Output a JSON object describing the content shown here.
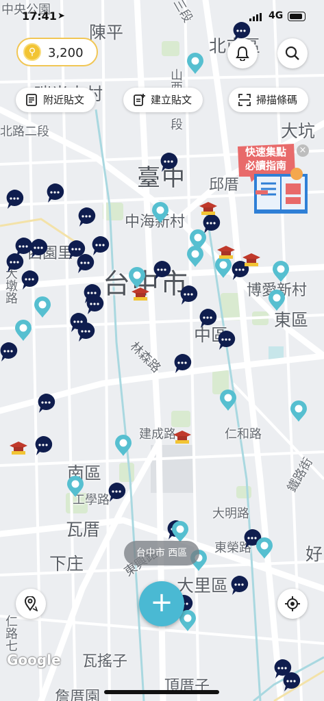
{
  "status_bar": {
    "time": "17:41",
    "network": "4G"
  },
  "coins": {
    "value": "3,200"
  },
  "buttons": {
    "nearby_posts": "附近貼文",
    "create_post": "建立貼文",
    "scan_barcode": "掃描條碼"
  },
  "promo": {
    "line1": "快速集點",
    "line2": "必讀指南"
  },
  "map_labels": {
    "zhongyang": "中央公園",
    "chenping": "陳平",
    "beitun": "北屯區",
    "beitun_ext": "北屯",
    "xuezhe": "瑞光大村",
    "road_2": "北路二段",
    "shanxi": "山西路一段",
    "sanhe": "三段",
    "dakeng": "大坑",
    "taichung_cn": "臺中",
    "qiu": "邱厝",
    "zhonghai": "中海新村",
    "xitun_park": "西園里",
    "dadu": "大墩路",
    "taichung_city": "台中市",
    "boai": "博愛新村",
    "east": "東區",
    "linsen": "林森路",
    "zhongqu": "中區",
    "jiancheng": "建成路",
    "renhe": "仁和路",
    "nanqu": "南區",
    "tiegu": "鐵路街",
    "gongxue": "工學路",
    "damimg": "大明路",
    "wacuo": "瓦厝",
    "dongrong": "東榮路",
    "hao": "好",
    "xiazhuang": "下庄",
    "dongxing": "東興路",
    "dali": "大里區",
    "wayaozi": "瓦搖子",
    "dingcuo": "頂厝子",
    "road_left": "仁路七",
    "bottom_left": "詹厝園"
  },
  "region_chip": "台中市 西區",
  "fab": "+",
  "attribution": "Google",
  "colors": {
    "accent": "#4ab9d3",
    "coin_border": "#f1c654",
    "post_marker": "#0f1d4e",
    "teal_pin": "#56bfd0",
    "promo_red": "#e86a6a"
  },
  "icons": {
    "bell": "bell-icon",
    "search": "search-icon",
    "list": "list-icon",
    "add_post": "add-note-icon",
    "scan": "scan-icon",
    "location_pin": "location-pin-icon",
    "my_location": "crosshair-icon"
  }
}
